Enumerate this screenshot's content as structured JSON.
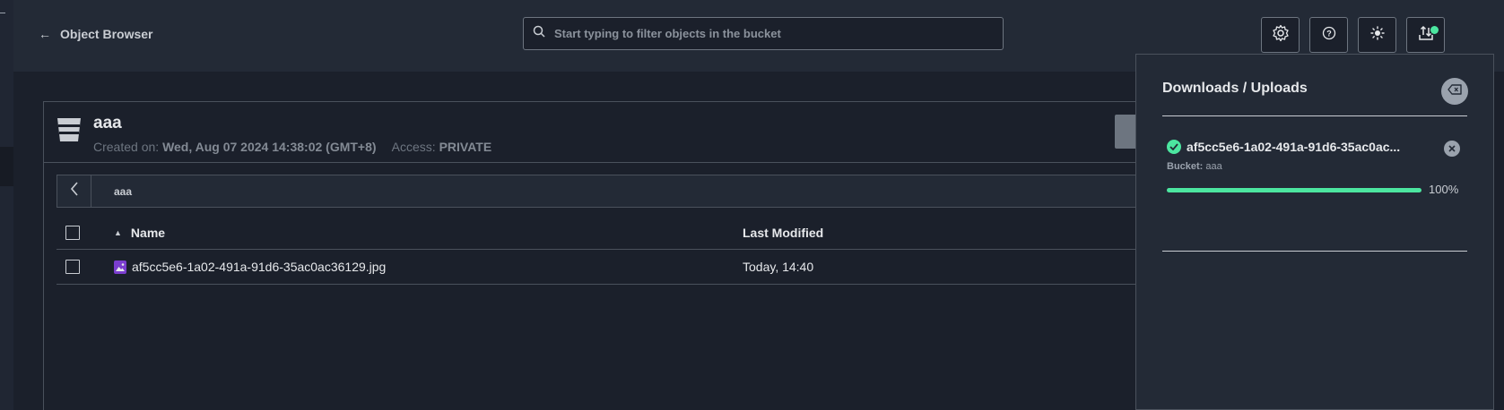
{
  "header": {
    "back_label": "Object Browser",
    "search_placeholder": "Start typing to filter objects in the bucket"
  },
  "bucket": {
    "name": "aaa",
    "created_label": "Created on:",
    "created_value": "Wed, Aug 07 2024 14:38:02 (GMT+8)",
    "access_label": "Access:",
    "access_value": "PRIVATE"
  },
  "breadcrumb": {
    "path": "aaa"
  },
  "table": {
    "columns": [
      "Name",
      "Last Modified"
    ],
    "rows": [
      {
        "name": "af5cc5e6-1a02-491a-91d6-35ac0ac36129.jpg",
        "modified": "Today, 14:40"
      }
    ]
  },
  "downloads": {
    "title": "Downloads / Uploads",
    "item": {
      "name": "af5cc5e6-1a02-491a-91d6-35ac0ac...",
      "bucket_label": "Bucket:",
      "bucket_value": "aaa",
      "progress": 100,
      "progress_text": "100%"
    }
  },
  "colors": {
    "accent_green": "#4ce6a0",
    "file_icon": "#7b3ecf"
  },
  "icons": [
    "arrow-left-icon",
    "search-icon",
    "gear-icon",
    "help-icon",
    "sun-icon",
    "upload-download-icon",
    "bucket-icon",
    "chevron-left-icon",
    "sort-up-icon",
    "image-file-icon",
    "check-circle-icon",
    "clear-icon",
    "close-icon"
  ]
}
